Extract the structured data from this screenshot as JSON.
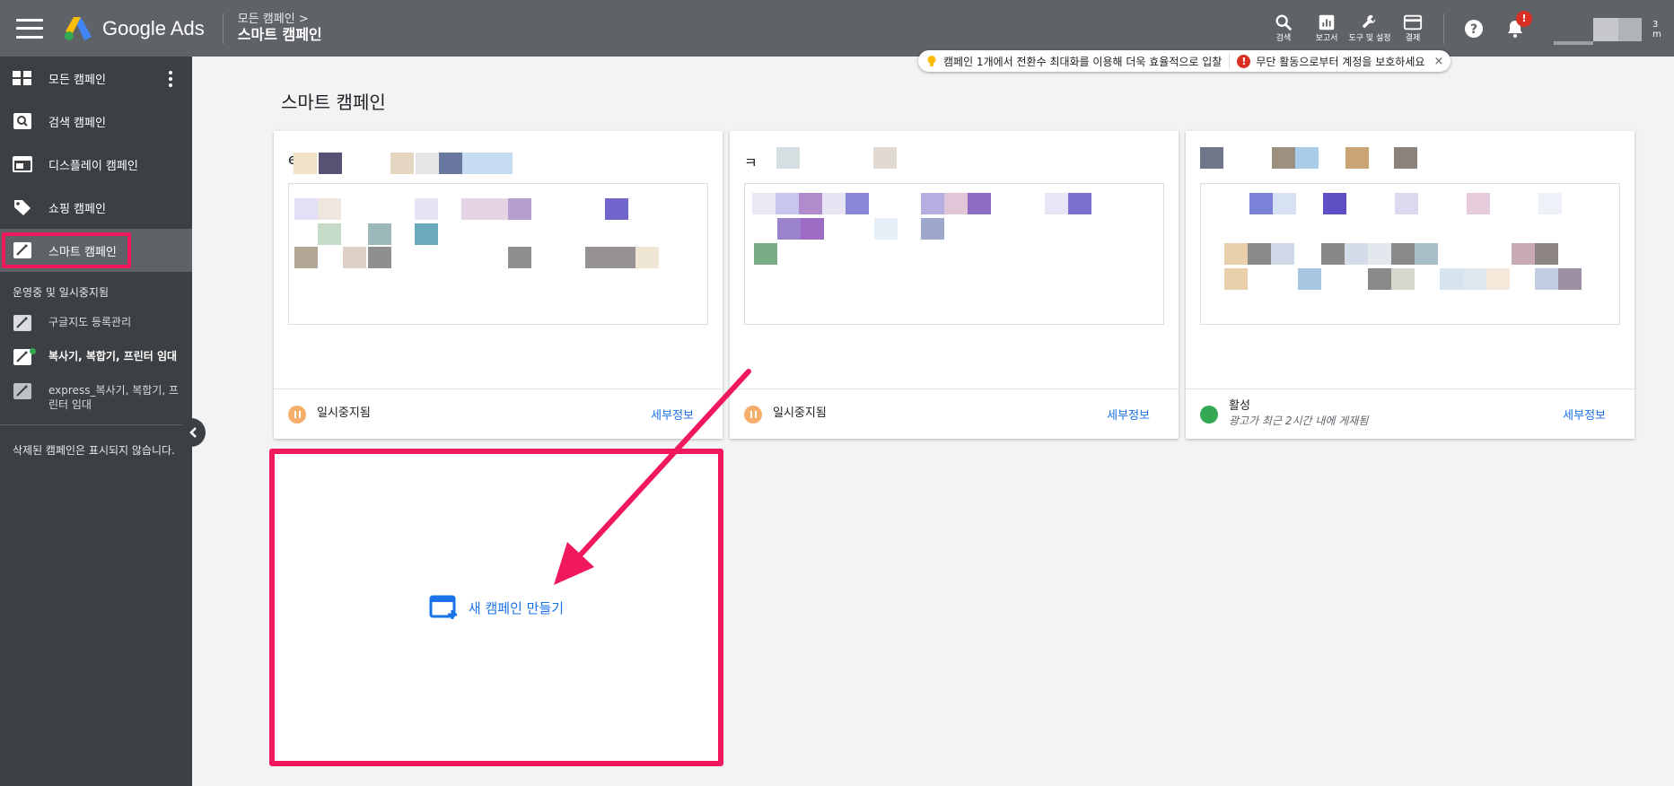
{
  "header": {
    "app_name": "Google Ads",
    "breadcrumb_parent": "모든 캠페인",
    "breadcrumb_current": "스마트 캠페인",
    "tools": [
      {
        "label": "검색",
        "icon": "search-icon"
      },
      {
        "label": "보고서",
        "icon": "reports-icon"
      },
      {
        "label": "도구 및 설정",
        "icon": "wrench-icon"
      },
      {
        "label": "결제",
        "icon": "billing-card-icon"
      }
    ],
    "notification_badge": "!",
    "account_suffix": "3 m"
  },
  "notifications": {
    "tip": "캠페인 1개에서 전환수 최대화를 이용해 더욱 효율적으로 입찰",
    "alert": "무단 활동으로부터 계정을 보호하세요",
    "close_label": "×"
  },
  "sidebar": {
    "items": [
      {
        "label": "모든 캠페인",
        "icon": "grid-icon"
      },
      {
        "label": "검색 캠페인",
        "icon": "search-campaign-icon"
      },
      {
        "label": "디스플레이 캠페인",
        "icon": "display-icon"
      },
      {
        "label": "쇼핑 캠페인",
        "icon": "tag-icon"
      },
      {
        "label": "스마트 캠페인",
        "icon": "smart-wand-icon",
        "active": true
      }
    ],
    "section_label": "운영중 및 일시중지됨",
    "campaigns": [
      {
        "label": "구글지도 등록관리"
      },
      {
        "label": "복사기, 복합기, 프린터 임대"
      },
      {
        "label": "express_복사기, 복합기, 프린터 임대"
      }
    ],
    "deleted_note": "삭제된 캠페인은 표시되지 않습니다."
  },
  "main": {
    "title": "스마트 캠페인",
    "cards": [
      {
        "name_initial": "e",
        "status": "일시중지됨",
        "status_sub": "",
        "details": "세부정보"
      },
      {
        "name_initial": "ㅋ",
        "status": "일시중지됨",
        "status_sub": "",
        "details": "세부정보"
      },
      {
        "name_initial": "",
        "status": "활성",
        "status_sub": "광고가 최근 2시간 내에 게재됨",
        "details": "세부정보"
      }
    ],
    "new_campaign_label": "새 캠페인 만들기"
  },
  "colors": {
    "header_bg": "#5f6368",
    "sidebar_bg": "#3c4043",
    "highlight": "#f0195d",
    "link": "#1a73e8",
    "paused": "#f6ae6b",
    "active": "#34a853"
  }
}
